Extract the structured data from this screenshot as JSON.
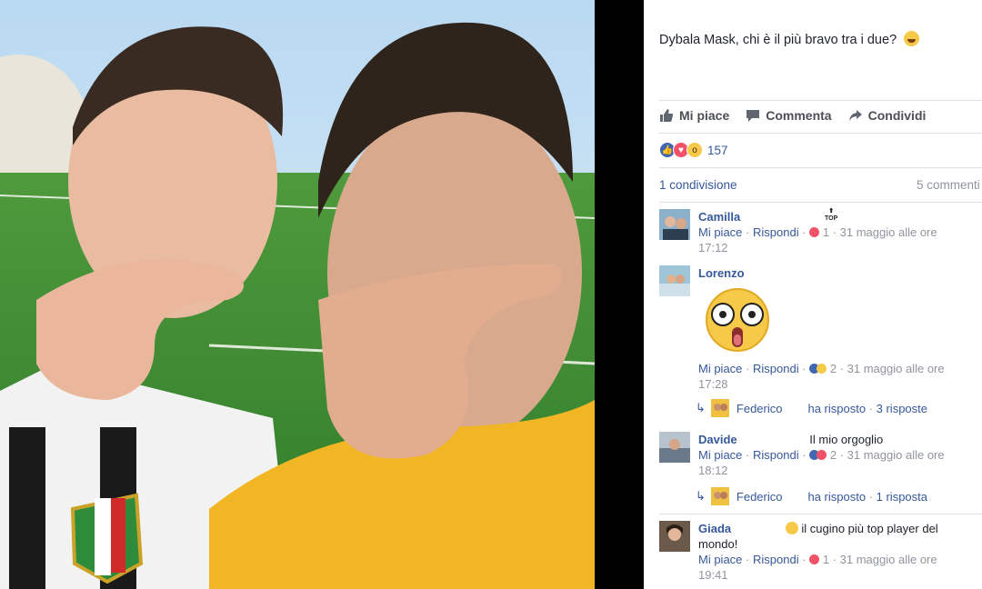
{
  "post": {
    "caption": "Dybala Mask, chi è il più bravo tra i due?",
    "caption_emoji": "laughing-emoji"
  },
  "actions": {
    "like": "Mi piace",
    "comment": "Commenta",
    "share": "Condividi"
  },
  "reactions": {
    "icons": [
      "like",
      "love",
      "wow"
    ],
    "count": "157"
  },
  "shares": "1 condivisione",
  "comments_count": "5 commenti",
  "top_badge": "TOP",
  "comments": [
    {
      "author": "Camilla",
      "text": "",
      "like": "Mi piace",
      "reply": "Rispondi",
      "reaction_count": "1",
      "time": "31 maggio alle ore",
      "time2": "17:12"
    },
    {
      "author": "Lorenzo",
      "text": "",
      "sticker": "surprised-face-sticker",
      "like": "Mi piace",
      "reply": "Rispondi",
      "reaction_count": "2",
      "time": "31 maggio alle ore",
      "time2": "17:28",
      "reply_author": "Federico",
      "reply_text": "ha risposto",
      "reply_count": "3 risposte"
    },
    {
      "author": "Davide",
      "text": "Il mio orgoglio",
      "like": "Mi piace",
      "reply": "Rispondi",
      "reaction_count": "2",
      "time": "31 maggio alle ore",
      "time2": "18:12",
      "reply_author": "Federico",
      "reply_text": "ha risposto",
      "reply_count": "1 risposta"
    },
    {
      "author": "Giada",
      "text": "il cugino più top player del mondo!",
      "like": "Mi piace",
      "reply": "Rispondi",
      "reaction_count": "1",
      "time": "31 maggio alle ore",
      "time2": "19:41"
    }
  ],
  "colors": {
    "link": "#365899",
    "meta": "#90949c",
    "text": "#1d2129",
    "like": "#4267b2",
    "love": "#f25268"
  }
}
